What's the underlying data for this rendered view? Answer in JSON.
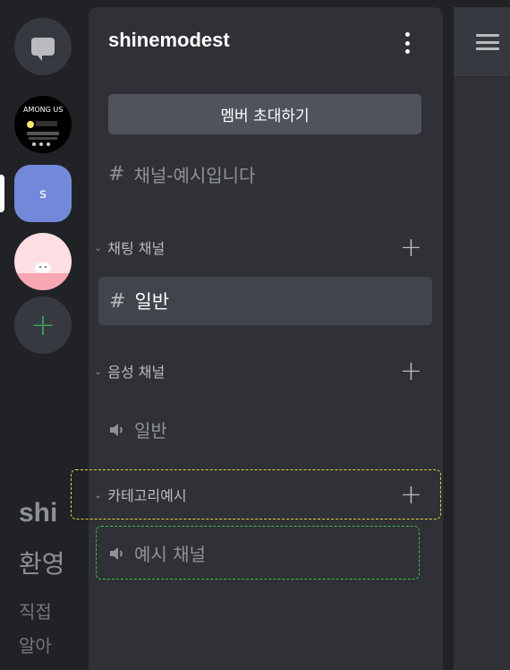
{
  "servers": [
    {
      "name": "direct-messages"
    },
    {
      "name": "among-us-server"
    },
    {
      "name": "s-server",
      "initial": "s"
    },
    {
      "name": "pink-cat-server"
    },
    {
      "name": "add-server",
      "symbol": "+"
    }
  ],
  "guild": {
    "name": "shinemodest",
    "invite_label": "멤버 초대하기",
    "top_channel": "채널-예시입니다"
  },
  "categories": [
    {
      "label": "채팅 채널",
      "channels": [
        {
          "label": "일반",
          "type": "text",
          "selected": true
        }
      ]
    },
    {
      "label": "음성 채널",
      "channels": [
        {
          "label": "일반",
          "type": "voice"
        }
      ]
    },
    {
      "label": "카테고리예시",
      "channels": [
        {
          "label": "예시 채널",
          "type": "voice"
        }
      ]
    }
  ],
  "main": {
    "title": "shi",
    "subtitle": "환영",
    "line1": "직접",
    "line2": "알아"
  },
  "colors": {
    "accent": "#7289da",
    "add": "#3ba55c",
    "highlight_yellow": "#e2d430",
    "highlight_green": "#3cc04a"
  }
}
